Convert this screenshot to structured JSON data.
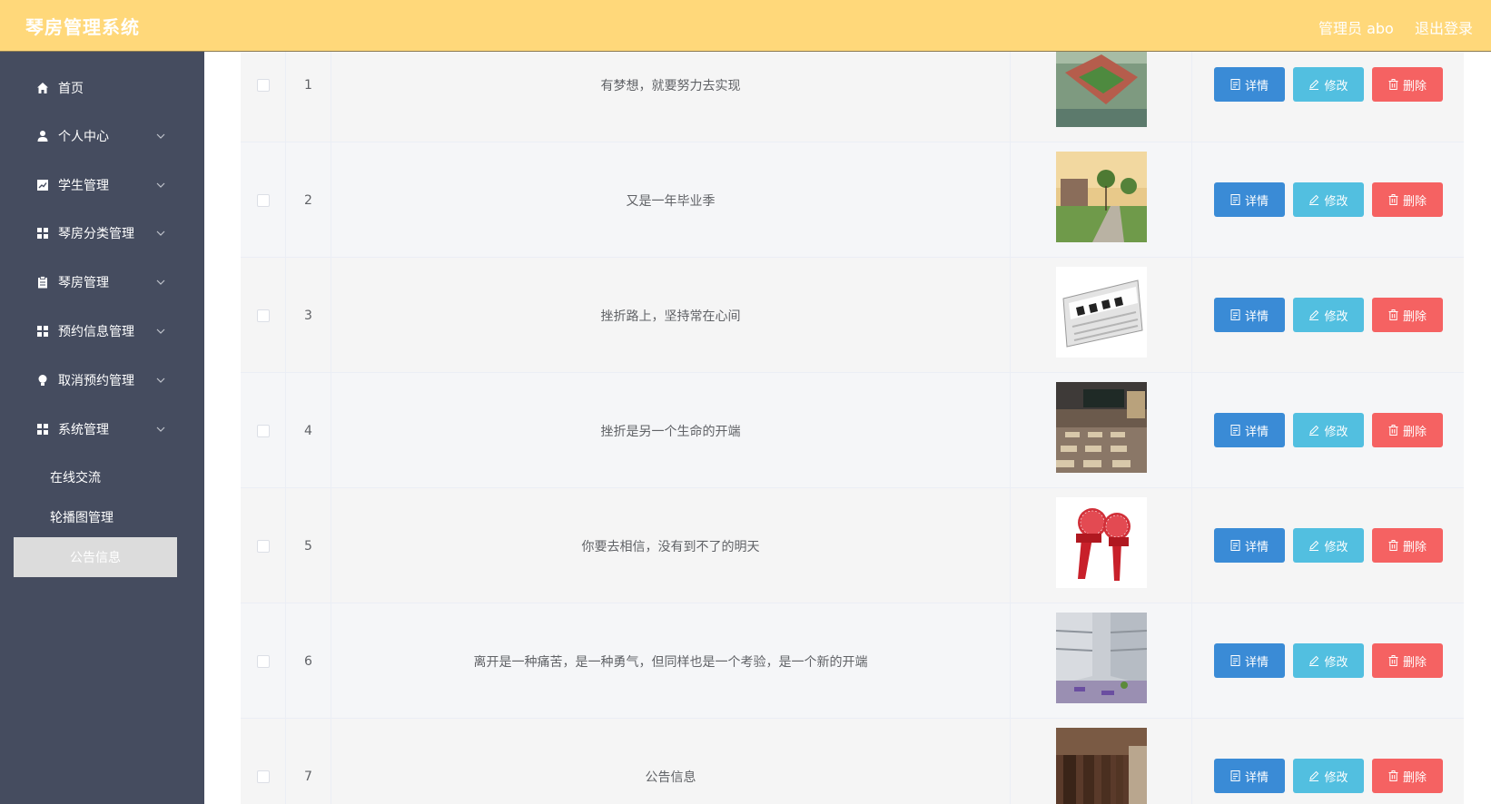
{
  "header": {
    "title": "琴房管理系统",
    "admin": "管理员 abo",
    "logout": "退出登录"
  },
  "sidebar": {
    "items": [
      {
        "label": "首页",
        "icon": "home-icon"
      },
      {
        "label": "个人中心",
        "icon": "user-icon"
      },
      {
        "label": "学生管理",
        "icon": "chart-icon"
      },
      {
        "label": "琴房分类管理",
        "icon": "grid-icon"
      },
      {
        "label": "琴房管理",
        "icon": "clipboard-icon"
      },
      {
        "label": "预约信息管理",
        "icon": "grid-icon"
      },
      {
        "label": "取消预约管理",
        "icon": "bulb-icon"
      },
      {
        "label": "系统管理",
        "icon": "grid-icon"
      }
    ],
    "subitems": [
      {
        "label": "在线交流"
      },
      {
        "label": "轮播图管理"
      },
      {
        "label": "公告信息"
      }
    ]
  },
  "table": {
    "rows": [
      {
        "index": "1",
        "title": "有梦想，就要努力去实现",
        "image": "campus-aerial"
      },
      {
        "index": "2",
        "title": "又是一年毕业季",
        "image": "campus-trees"
      },
      {
        "index": "3",
        "title": "挫折路上，坚持常在心间",
        "image": "news-paper"
      },
      {
        "index": "4",
        "title": "挫折是另一个生命的开端",
        "image": "classroom"
      },
      {
        "index": "5",
        "title": "你要去相信，没有到不了的明天",
        "image": "news-microphone"
      },
      {
        "index": "6",
        "title": "离开是一种痛苦，是一种勇气，但同样也是一个考验，是一个新的开端",
        "image": "building-courtyard"
      },
      {
        "index": "7",
        "title": "公告信息",
        "image": "study-room"
      }
    ],
    "buttons": {
      "detail": "详情",
      "edit": "修改",
      "delete": "删除"
    }
  }
}
